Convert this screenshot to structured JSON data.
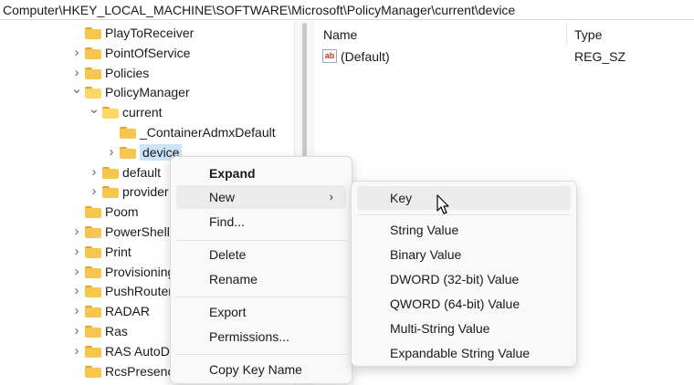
{
  "address_bar": {
    "path": "Computer\\HKEY_LOCAL_MACHINE\\SOFTWARE\\Microsoft\\PolicyManager\\current\\device"
  },
  "tree": {
    "items": [
      {
        "label": "PlayToReceiver",
        "depth": 0,
        "expander": "none"
      },
      {
        "label": "PointOfService",
        "depth": 0,
        "expander": "collapsed"
      },
      {
        "label": "Policies",
        "depth": 0,
        "expander": "collapsed"
      },
      {
        "label": "PolicyManager",
        "depth": 0,
        "expander": "expanded"
      },
      {
        "label": "current",
        "depth": 1,
        "expander": "expanded"
      },
      {
        "label": "_ContainerAdmxDefault",
        "depth": 2,
        "expander": "none"
      },
      {
        "label": "device",
        "depth": 2,
        "expander": "collapsed",
        "selected": true
      },
      {
        "label": "default",
        "depth": 1,
        "expander": "collapsed"
      },
      {
        "label": "provider",
        "depth": 1,
        "expander": "collapsed"
      },
      {
        "label": "Poom",
        "depth": 0,
        "expander": "none"
      },
      {
        "label": "PowerShell",
        "depth": 0,
        "expander": "collapsed"
      },
      {
        "label": "Print",
        "depth": 0,
        "expander": "collapsed"
      },
      {
        "label": "Provisioning",
        "depth": 0,
        "expander": "collapsed"
      },
      {
        "label": "PushRouter",
        "depth": 0,
        "expander": "collapsed"
      },
      {
        "label": "RADAR",
        "depth": 0,
        "expander": "collapsed"
      },
      {
        "label": "Ras",
        "depth": 0,
        "expander": "collapsed"
      },
      {
        "label": "RAS AutoD",
        "depth": 0,
        "expander": "collapsed"
      },
      {
        "label": "RcsPresence",
        "depth": 0,
        "expander": "none"
      }
    ]
  },
  "list": {
    "columns": {
      "name": "Name",
      "type": "Type"
    },
    "rows": [
      {
        "name": "(Default)",
        "type": "REG_SZ"
      }
    ]
  },
  "context_menu": {
    "expand": "Expand",
    "new": "New",
    "find": "Find...",
    "delete": "Delete",
    "rename": "Rename",
    "export": "Export",
    "permissions": "Permissions...",
    "copy_key_name": "Copy Key Name"
  },
  "submenu": {
    "items": [
      "Key",
      "String Value",
      "Binary Value",
      "DWORD (32-bit) Value",
      "QWORD (64-bit) Value",
      "Multi-String Value",
      "Expandable String Value"
    ]
  }
}
